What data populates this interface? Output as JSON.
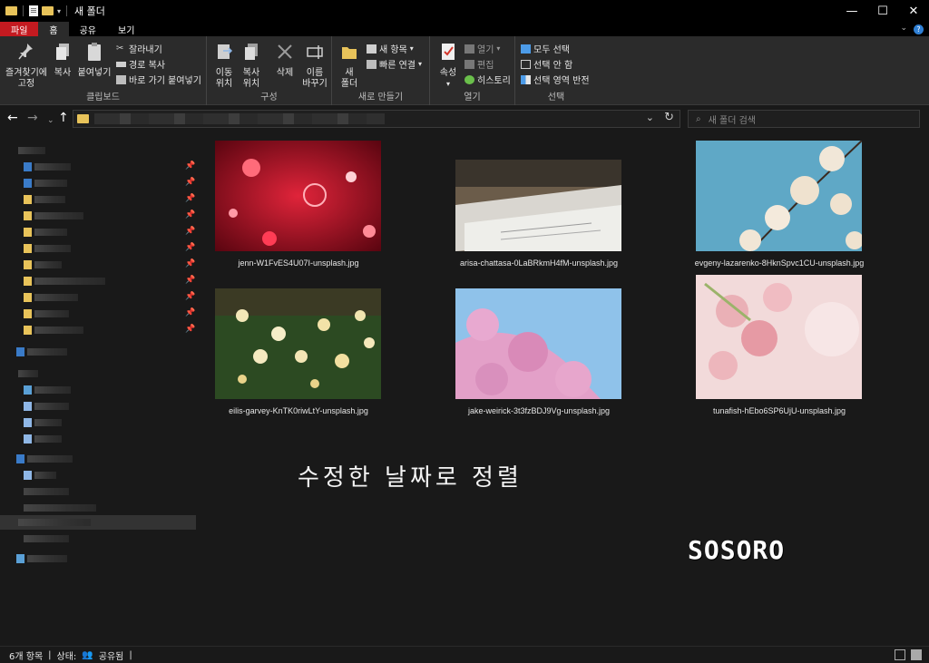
{
  "window": {
    "title": "새 폴더",
    "controls": {
      "minimize": "—",
      "maximize": "☐",
      "close": "✕"
    }
  },
  "ribbon_tabs": [
    "파일",
    "홈",
    "공유",
    "보기"
  ],
  "help": "?",
  "ribbon": {
    "clipboard": {
      "label": "클립보드",
      "pin": "즐겨찾기에\n고정",
      "copy": "복사",
      "paste": "붙여넣기",
      "cut": "잘라내기",
      "copy_path": "경로 복사",
      "paste_shortcut": "바로 가기 붙여넣기"
    },
    "organize": {
      "label": "구성",
      "move_to": "이동\n위치",
      "copy_to": "복사\n위치",
      "delete": "삭제",
      "rename": "이름\n바꾸기"
    },
    "new": {
      "label": "새로 만들기",
      "new_folder": "새\n폴더",
      "new_item": "새 항목",
      "easy_access": "빠른 연결"
    },
    "open": {
      "label": "열기",
      "properties": "속성",
      "open": "열기",
      "edit": "편집",
      "history": "히스토리"
    },
    "select": {
      "label": "선택",
      "select_all": "모두 선택",
      "select_none": "선택 안 함",
      "invert": "선택 영역 반전"
    }
  },
  "search": {
    "placeholder": "새 폴더 검색"
  },
  "files": [
    {
      "name": "jenn-W1FvES4U07I-unsplash.jpg"
    },
    {
      "name": "arisa-chattasa-0LaBRkmH4fM-unsplash.jpg"
    },
    {
      "name": "evgeny-lazarenko-8HknSpvc1CU-unsplash.jpg"
    },
    {
      "name": "eilis-garvey-KnTK0riwLtY-unsplash.jpg"
    },
    {
      "name": "jake-weirick-3t3fzBDJ9Vg-unsplash.jpg"
    },
    {
      "name": "tunafish-hEbo6SP6UjU-unsplash.jpg"
    }
  ],
  "overlay_text": "수정한 날짜로 정렬",
  "watermark": "SOSORO",
  "status": {
    "count": "6개 항목",
    "state": "상태:",
    "shared": "공유됨"
  },
  "colors": {
    "file_tab": "#c41a20",
    "background": "#191919",
    "ribbon": "#2b2b2b"
  }
}
